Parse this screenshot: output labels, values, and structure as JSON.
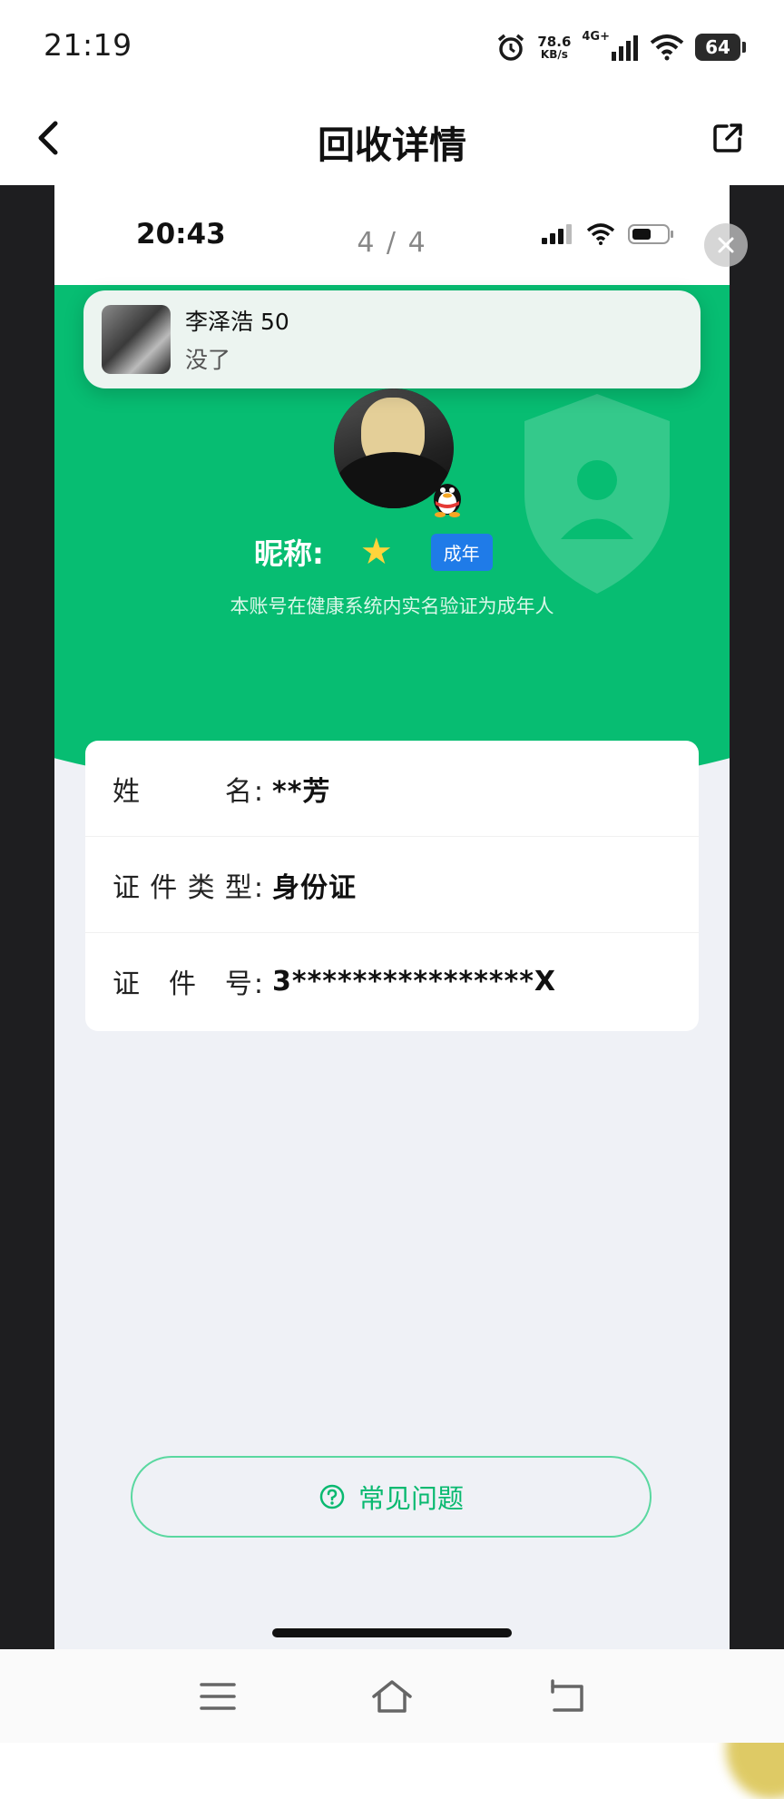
{
  "status_bar": {
    "time": "21:19",
    "net_speed_value": "78.6",
    "net_speed_unit": "KB/s",
    "net_type": "4G+",
    "battery": "64"
  },
  "nav": {
    "title": "回收详情"
  },
  "phone": {
    "time": "20:43",
    "page_counter": "4 / 4",
    "notification": {
      "title": "李泽浩 50",
      "body": "没了"
    },
    "nickname_label": "昵称:",
    "adult_badge": "成年",
    "verify_text": "本账号在健康系统内实名验证为成年人",
    "info": {
      "name_label": [
        "姓",
        "名:"
      ],
      "name_value": "**芳",
      "id_type_label": [
        "证",
        "件",
        "类",
        "型:"
      ],
      "id_type_value": "身份证",
      "id_no_label": [
        "证",
        "件",
        "号:"
      ],
      "id_no_value": "3****************X"
    },
    "faq_button": "常见问题"
  },
  "colors": {
    "brand_green": "#07bd72",
    "badge_blue": "#1f7be8"
  }
}
